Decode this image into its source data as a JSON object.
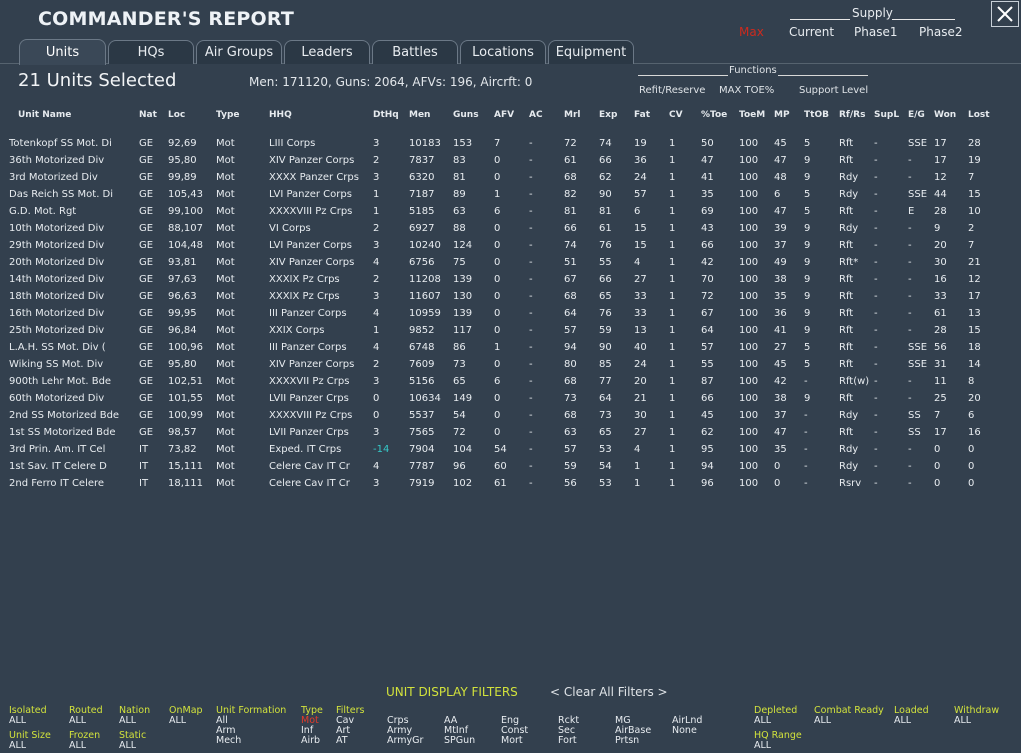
{
  "window": {
    "title": "COMMANDER'S REPORT"
  },
  "supply": {
    "label": "Supply",
    "options": [
      "Max",
      "Current",
      "Phase1",
      "Phase2"
    ],
    "selected": "Max",
    "selected_color": "#cc2a1e"
  },
  "tabs": [
    {
      "label": "Units",
      "active": true
    },
    {
      "label": "HQs",
      "active": false
    },
    {
      "label": "Air Groups",
      "active": false
    },
    {
      "label": "Leaders",
      "active": false
    },
    {
      "label": "Battles",
      "active": false
    },
    {
      "label": "Locations",
      "active": false
    },
    {
      "label": "Equipment",
      "active": false
    }
  ],
  "summary": {
    "units_selected": "21 Units Selected",
    "totals": "Men: 171120, Guns: 2064, AFVs: 196, Aircrft: 0"
  },
  "functions": {
    "label": "Functions",
    "options": [
      "Refit/Reserve",
      "MAX TOE%",
      "Support Level"
    ]
  },
  "table": {
    "headers": [
      "Unit Name",
      "Nat",
      "Loc",
      "Type",
      "HHQ",
      "DtHq",
      "Men",
      "Guns",
      "AFV",
      "AC",
      "Mrl",
      "Exp",
      "Fat",
      "CV",
      "%Toe",
      "ToeM",
      "MP",
      "TtOB",
      "Rf/Rs",
      "SupL",
      "E/G",
      "Won",
      "Lost"
    ],
    "rows": [
      [
        "Totenkopf SS Mot. Di",
        "GE",
        "92,69",
        "Mot",
        "LIII Corps",
        "3",
        "10183",
        "153",
        "7",
        "-",
        "72",
        "74",
        "19",
        "1",
        "50",
        "100",
        "45",
        "5",
        "Rft",
        "-",
        "SSE",
        "17",
        "28"
      ],
      [
        "36th Motorized Div",
        "GE",
        "95,80",
        "Mot",
        "XIV Panzer Corps",
        "2",
        "7837",
        "83",
        "0",
        "-",
        "61",
        "66",
        "36",
        "1",
        "47",
        "100",
        "47",
        "9",
        "Rft",
        "-",
        "-",
        "17",
        "19"
      ],
      [
        "3rd Motorized Div",
        "GE",
        "99,89",
        "Mot",
        "XXXX Panzer Crps",
        "3",
        "6320",
        "81",
        "0",
        "-",
        "68",
        "62",
        "24",
        "1",
        "41",
        "100",
        "48",
        "9",
        "Rdy",
        "-",
        "-",
        "12",
        "7"
      ],
      [
        "Das Reich SS Mot. Di",
        "GE",
        "105,43",
        "Mot",
        "LVI Panzer Corps",
        "1",
        "7187",
        "89",
        "1",
        "-",
        "82",
        "90",
        "57",
        "1",
        "35",
        "100",
        "6",
        "5",
        "Rdy",
        "-",
        "SSE",
        "44",
        "15"
      ],
      [
        "G.D. Mot. Rgt",
        "GE",
        "99,100",
        "Mot",
        "XXXXVIII Pz Crps",
        "1",
        "5185",
        "63",
        "6",
        "-",
        "81",
        "81",
        "6",
        "1",
        "69",
        "100",
        "47",
        "5",
        "Rft",
        "-",
        "E",
        "28",
        "10"
      ],
      [
        "10th Motorized Div",
        "GE",
        "88,107",
        "Mot",
        "VI Corps",
        "2",
        "6927",
        "88",
        "0",
        "-",
        "66",
        "61",
        "15",
        "1",
        "43",
        "100",
        "39",
        "9",
        "Rdy",
        "-",
        "-",
        "9",
        "2"
      ],
      [
        "29th Motorized Div",
        "GE",
        "104,48",
        "Mot",
        "LVI Panzer Corps",
        "3",
        "10240",
        "124",
        "0",
        "-",
        "74",
        "76",
        "15",
        "1",
        "66",
        "100",
        "37",
        "9",
        "Rft",
        "-",
        "-",
        "20",
        "7"
      ],
      [
        "20th Motorized Div",
        "GE",
        "93,81",
        "Mot",
        "XIV Panzer Corps",
        "4",
        "6756",
        "75",
        "0",
        "-",
        "51",
        "55",
        "4",
        "1",
        "42",
        "100",
        "49",
        "9",
        "Rft*",
        "-",
        "-",
        "30",
        "21"
      ],
      [
        "14th Motorized Div",
        "GE",
        "97,63",
        "Mot",
        "XXXIX Pz Crps",
        "2",
        "11208",
        "139",
        "0",
        "-",
        "67",
        "66",
        "27",
        "1",
        "70",
        "100",
        "38",
        "9",
        "Rft",
        "-",
        "-",
        "16",
        "12"
      ],
      [
        "18th Motorized Div",
        "GE",
        "96,63",
        "Mot",
        "XXXIX Pz Crps",
        "3",
        "11607",
        "130",
        "0",
        "-",
        "68",
        "65",
        "33",
        "1",
        "72",
        "100",
        "35",
        "9",
        "Rft",
        "-",
        "-",
        "33",
        "17"
      ],
      [
        "16th Motorized Div",
        "GE",
        "99,95",
        "Mot",
        "III Panzer Corps",
        "4",
        "10959",
        "139",
        "0",
        "-",
        "64",
        "76",
        "33",
        "1",
        "67",
        "100",
        "36",
        "9",
        "Rft",
        "-",
        "-",
        "61",
        "13"
      ],
      [
        "25th Motorized Div",
        "GE",
        "96,84",
        "Mot",
        "XXIX Corps",
        "1",
        "9852",
        "117",
        "0",
        "-",
        "57",
        "59",
        "13",
        "1",
        "64",
        "100",
        "41",
        "9",
        "Rft",
        "-",
        "-",
        "28",
        "15"
      ],
      [
        "L.A.H. SS Mot. Div (",
        "GE",
        "100,96",
        "Mot",
        "III Panzer Corps",
        "4",
        "6748",
        "86",
        "1",
        "-",
        "94",
        "90",
        "40",
        "1",
        "57",
        "100",
        "27",
        "5",
        "Rft",
        "-",
        "SSE",
        "56",
        "18"
      ],
      [
        "Wiking SS Mot. Div",
        "GE",
        "95,80",
        "Mot",
        "XIV Panzer Corps",
        "2",
        "7609",
        "73",
        "0",
        "-",
        "80",
        "85",
        "24",
        "1",
        "55",
        "100",
        "45",
        "5",
        "Rft",
        "-",
        "SSE",
        "31",
        "14"
      ],
      [
        "900th Lehr Mot. Bde",
        "GE",
        "102,51",
        "Mot",
        "XXXXVII Pz Crps",
        "3",
        "5156",
        "65",
        "6",
        "-",
        "68",
        "77",
        "20",
        "1",
        "87",
        "100",
        "42",
        "-",
        "Rft(w)",
        "-",
        "-",
        "11",
        "8"
      ],
      [
        "60th Motorized Div",
        "GE",
        "101,55",
        "Mot",
        "LVII Panzer Crps",
        "0",
        "10634",
        "149",
        "0",
        "-",
        "73",
        "64",
        "21",
        "1",
        "66",
        "100",
        "38",
        "9",
        "Rft",
        "-",
        "-",
        "25",
        "20"
      ],
      [
        "2nd SS Motorized Bde",
        "GE",
        "100,99",
        "Mot",
        "XXXXVIII Pz Crps",
        "0",
        "5537",
        "54",
        "0",
        "-",
        "68",
        "73",
        "30",
        "1",
        "45",
        "100",
        "37",
        "-",
        "Rdy",
        "-",
        "SS",
        "7",
        "6"
      ],
      [
        "1st SS Motorized Bde",
        "GE",
        "98,57",
        "Mot",
        "LVII Panzer Crps",
        "3",
        "7565",
        "72",
        "0",
        "-",
        "63",
        "65",
        "27",
        "1",
        "62",
        "100",
        "47",
        "-",
        "Rft",
        "-",
        "SS",
        "17",
        "16"
      ],
      [
        "3rd Prin. Am. IT Cel",
        "IT",
        "73,82",
        "Mot",
        "Exped. IT Crps",
        "-14",
        "7904",
        "104",
        "54",
        "-",
        "57",
        "53",
        "4",
        "1",
        "95",
        "100",
        "35",
        "-",
        "Rdy",
        "-",
        "-",
        "0",
        "0"
      ],
      [
        "1st Sav. IT Celere D",
        "IT",
        "15,111",
        "Mot",
        "Celere Cav IT Cr",
        "4",
        "7787",
        "96",
        "60",
        "-",
        "59",
        "54",
        "1",
        "1",
        "94",
        "100",
        "0",
        "-",
        "Rdy",
        "-",
        "-",
        "0",
        "0"
      ],
      [
        "2nd Ferro IT Celere",
        "IT",
        "18,111",
        "Mot",
        "Celere Cav IT Cr",
        "3",
        "7919",
        "102",
        "61",
        "-",
        "56",
        "53",
        "1",
        "1",
        "96",
        "100",
        "0",
        "-",
        "Rsrv",
        "-",
        "-",
        "0",
        "0"
      ]
    ],
    "negative_color": "#35c9c9"
  },
  "filters": {
    "title": "UNIT DISPLAY FILTERS",
    "clear_all": "< Clear All Filters >",
    "groups": [
      {
        "label": "Isolated",
        "values": [
          "ALL"
        ]
      },
      {
        "label": "Routed",
        "values": [
          "ALL"
        ]
      },
      {
        "label": "Nation",
        "values": [
          "ALL"
        ]
      },
      {
        "label": "OnMap",
        "values": [
          "ALL"
        ]
      },
      {
        "label": "Unit Formation",
        "values": [
          "All",
          "Arm",
          "Mech"
        ]
      },
      {
        "label": "Type",
        "values": [
          "Mot",
          "Inf",
          "Airb"
        ]
      },
      {
        "label": "Filters",
        "values": [
          "Cav",
          "Art",
          "AT"
        ]
      },
      {
        "label": "Unit Size",
        "values": [
          "ALL"
        ]
      },
      {
        "label": "Frozen",
        "values": [
          "ALL"
        ]
      },
      {
        "label": "Static",
        "values": [
          "ALL"
        ]
      },
      {
        "label": "Depleted",
        "values": [
          "ALL"
        ]
      },
      {
        "label": "Combat Ready",
        "values": [
          "ALL"
        ]
      },
      {
        "label": "Loaded",
        "values": [
          "ALL"
        ]
      },
      {
        "label": "Withdraw",
        "values": [
          "ALL"
        ]
      },
      {
        "label": "HQ Range",
        "values": [
          "ALL"
        ]
      }
    ],
    "type_columns": [
      [
        "Crps",
        "Army",
        "ArmyGr"
      ],
      [
        "AA",
        "MtInf",
        "SPGun"
      ],
      [
        "Eng",
        "Const",
        "Mort"
      ],
      [
        "Rckt",
        "Sec",
        "Fort"
      ],
      [
        "MG",
        "AirBase",
        "Prtsn"
      ],
      [
        "AirLnd",
        "None"
      ]
    ],
    "active_value": "Mot",
    "active_color": "#e33a2a",
    "label_color": "#d2e23c"
  }
}
